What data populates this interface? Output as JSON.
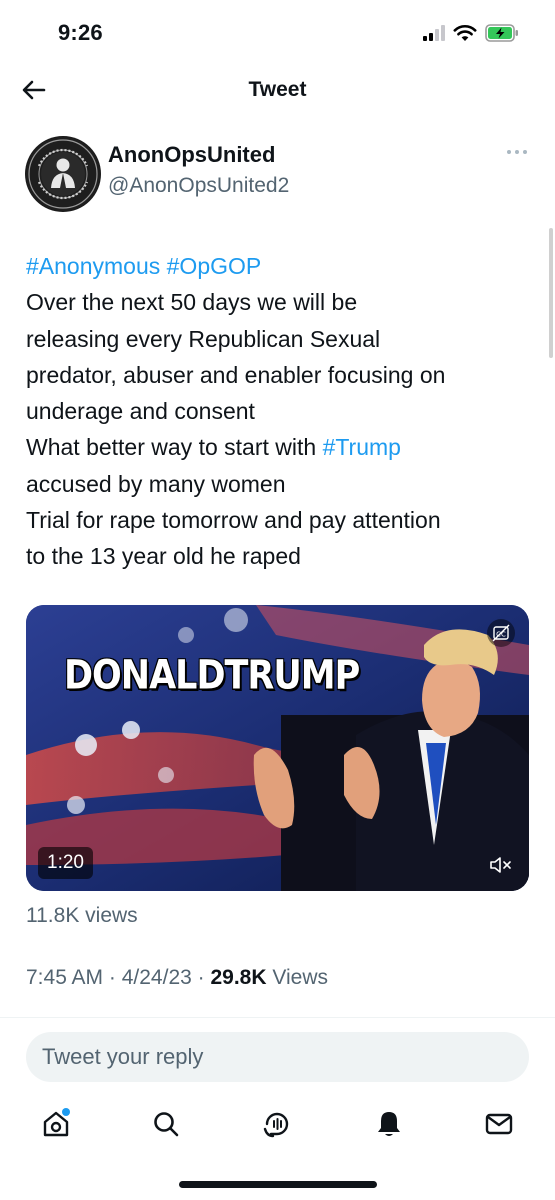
{
  "status": {
    "time": "9:26"
  },
  "header": {
    "title": "Tweet"
  },
  "user": {
    "name": "AnonOpsUnited",
    "handle": "@AnonOpsUnited2"
  },
  "tweet": {
    "lines": [
      [
        {
          "t": "#Anonymous",
          "tag": true
        },
        {
          "t": " "
        },
        {
          "t": "#OpGOP",
          "tag": true
        }
      ],
      [
        {
          "t": "Over the next 50 days we will be"
        }
      ],
      [
        {
          "t": "releasing every Republican Sexual"
        }
      ],
      [
        {
          "t": "predator, abuser and enabler focusing on"
        }
      ],
      [
        {
          "t": "underage and consent"
        }
      ],
      [
        {
          "t": "What better way to start with "
        },
        {
          "t": "#Trump",
          "tag": true
        }
      ],
      [
        {
          "t": "accused by many women"
        }
      ],
      [
        {
          "t": "Trial for rape tomorrow and pay attention"
        }
      ],
      [
        {
          "t": "to the 13 year old he raped"
        }
      ]
    ]
  },
  "media": {
    "caption": "DONALDTRUMP",
    "duration": "1:20",
    "views": "11.8K views"
  },
  "meta": {
    "time": "7:45 AM",
    "sep": " · ",
    "date": "4/24/23",
    "views_count": "29.8K",
    "views_label": "Views"
  },
  "reply": {
    "placeholder": "Tweet your reply"
  },
  "tabbar": {
    "items": [
      "home-icon",
      "search-icon",
      "spaces-icon",
      "notifications-icon",
      "messages-icon"
    ],
    "home_has_notification": true
  },
  "colors": {
    "accent": "#1d9bf0",
    "text": "#0f1419",
    "secondary": "#536471",
    "reply_bg": "#eff3f4"
  }
}
